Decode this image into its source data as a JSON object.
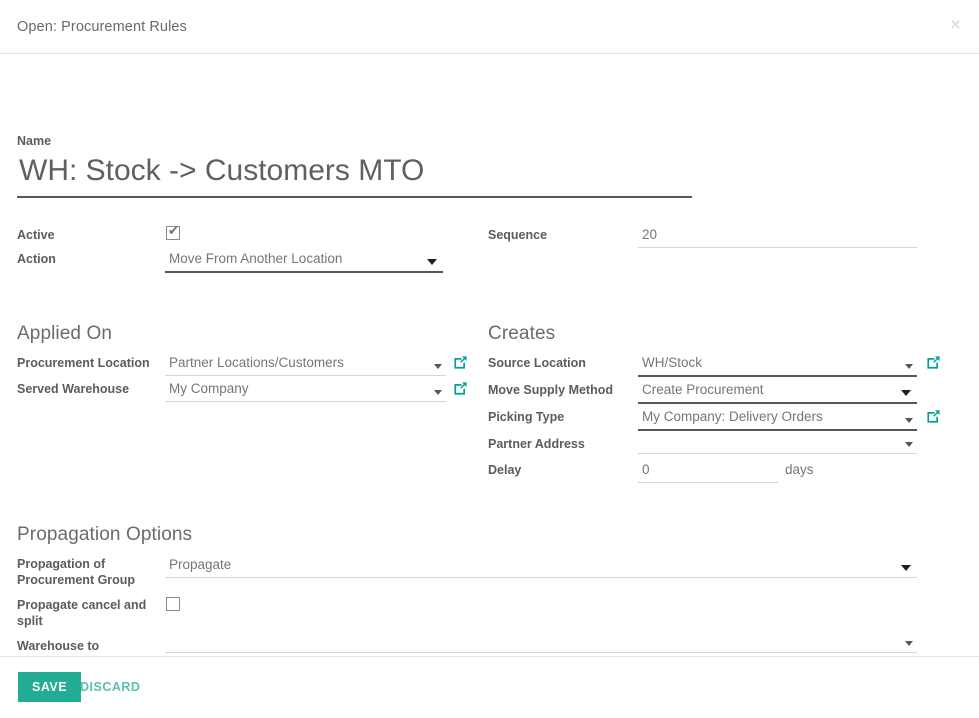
{
  "dialog": {
    "title": "Open: Procurement Rules",
    "close_icon": "close-icon",
    "close_glyph": "×"
  },
  "name_field": {
    "label": "Name",
    "value": "WH: Stock -> Customers MTO"
  },
  "top_fields": {
    "active": {
      "label": "Active",
      "checked": true,
      "tick": "✔"
    },
    "action": {
      "label": "Action",
      "value": "Move From Another Location"
    },
    "sequence": {
      "label": "Sequence",
      "value": "20"
    }
  },
  "applied_on": {
    "title": "Applied On",
    "fields": [
      {
        "label": "Procurement Location",
        "value": "Partner Locations/Customers",
        "has_link": true,
        "link_icon": "external-link-icon"
      },
      {
        "label": "Served Warehouse",
        "value": "My Company",
        "has_link": true,
        "link_icon": "external-link-icon"
      }
    ]
  },
  "creates": {
    "title": "Creates",
    "fields": [
      {
        "label": "Source Location",
        "value": "WH/Stock",
        "has_link": true,
        "link_icon": "external-link-icon"
      },
      {
        "label": "Move Supply Method",
        "value": "Create Procurement",
        "has_link": false
      },
      {
        "label": "Picking Type",
        "value": "My Company: Delivery Orders",
        "has_link": true,
        "link_icon": "external-link-icon"
      },
      {
        "label": "Partner Address",
        "value": "",
        "has_link": false
      },
      {
        "label": "Delay",
        "value": "0",
        "suffix": "days",
        "has_link": false
      }
    ]
  },
  "propagation": {
    "title": "Propagation Options",
    "group_label": "Propagation of Procurement Group",
    "group_value": "Propagate",
    "cancel_label": "Propagate cancel and split",
    "cancel_checked": false,
    "warehouse_label": "Warehouse to Propagate",
    "warehouse_value": ""
  },
  "footer": {
    "save_label": "SAVE",
    "discard_label": "DISCARD"
  },
  "colors": {
    "accent": "#23ad94",
    "discard": "#5bc0ae",
    "link_icon": "#00a09d",
    "text": "#5c5c5c",
    "value_text": "#72767c"
  }
}
